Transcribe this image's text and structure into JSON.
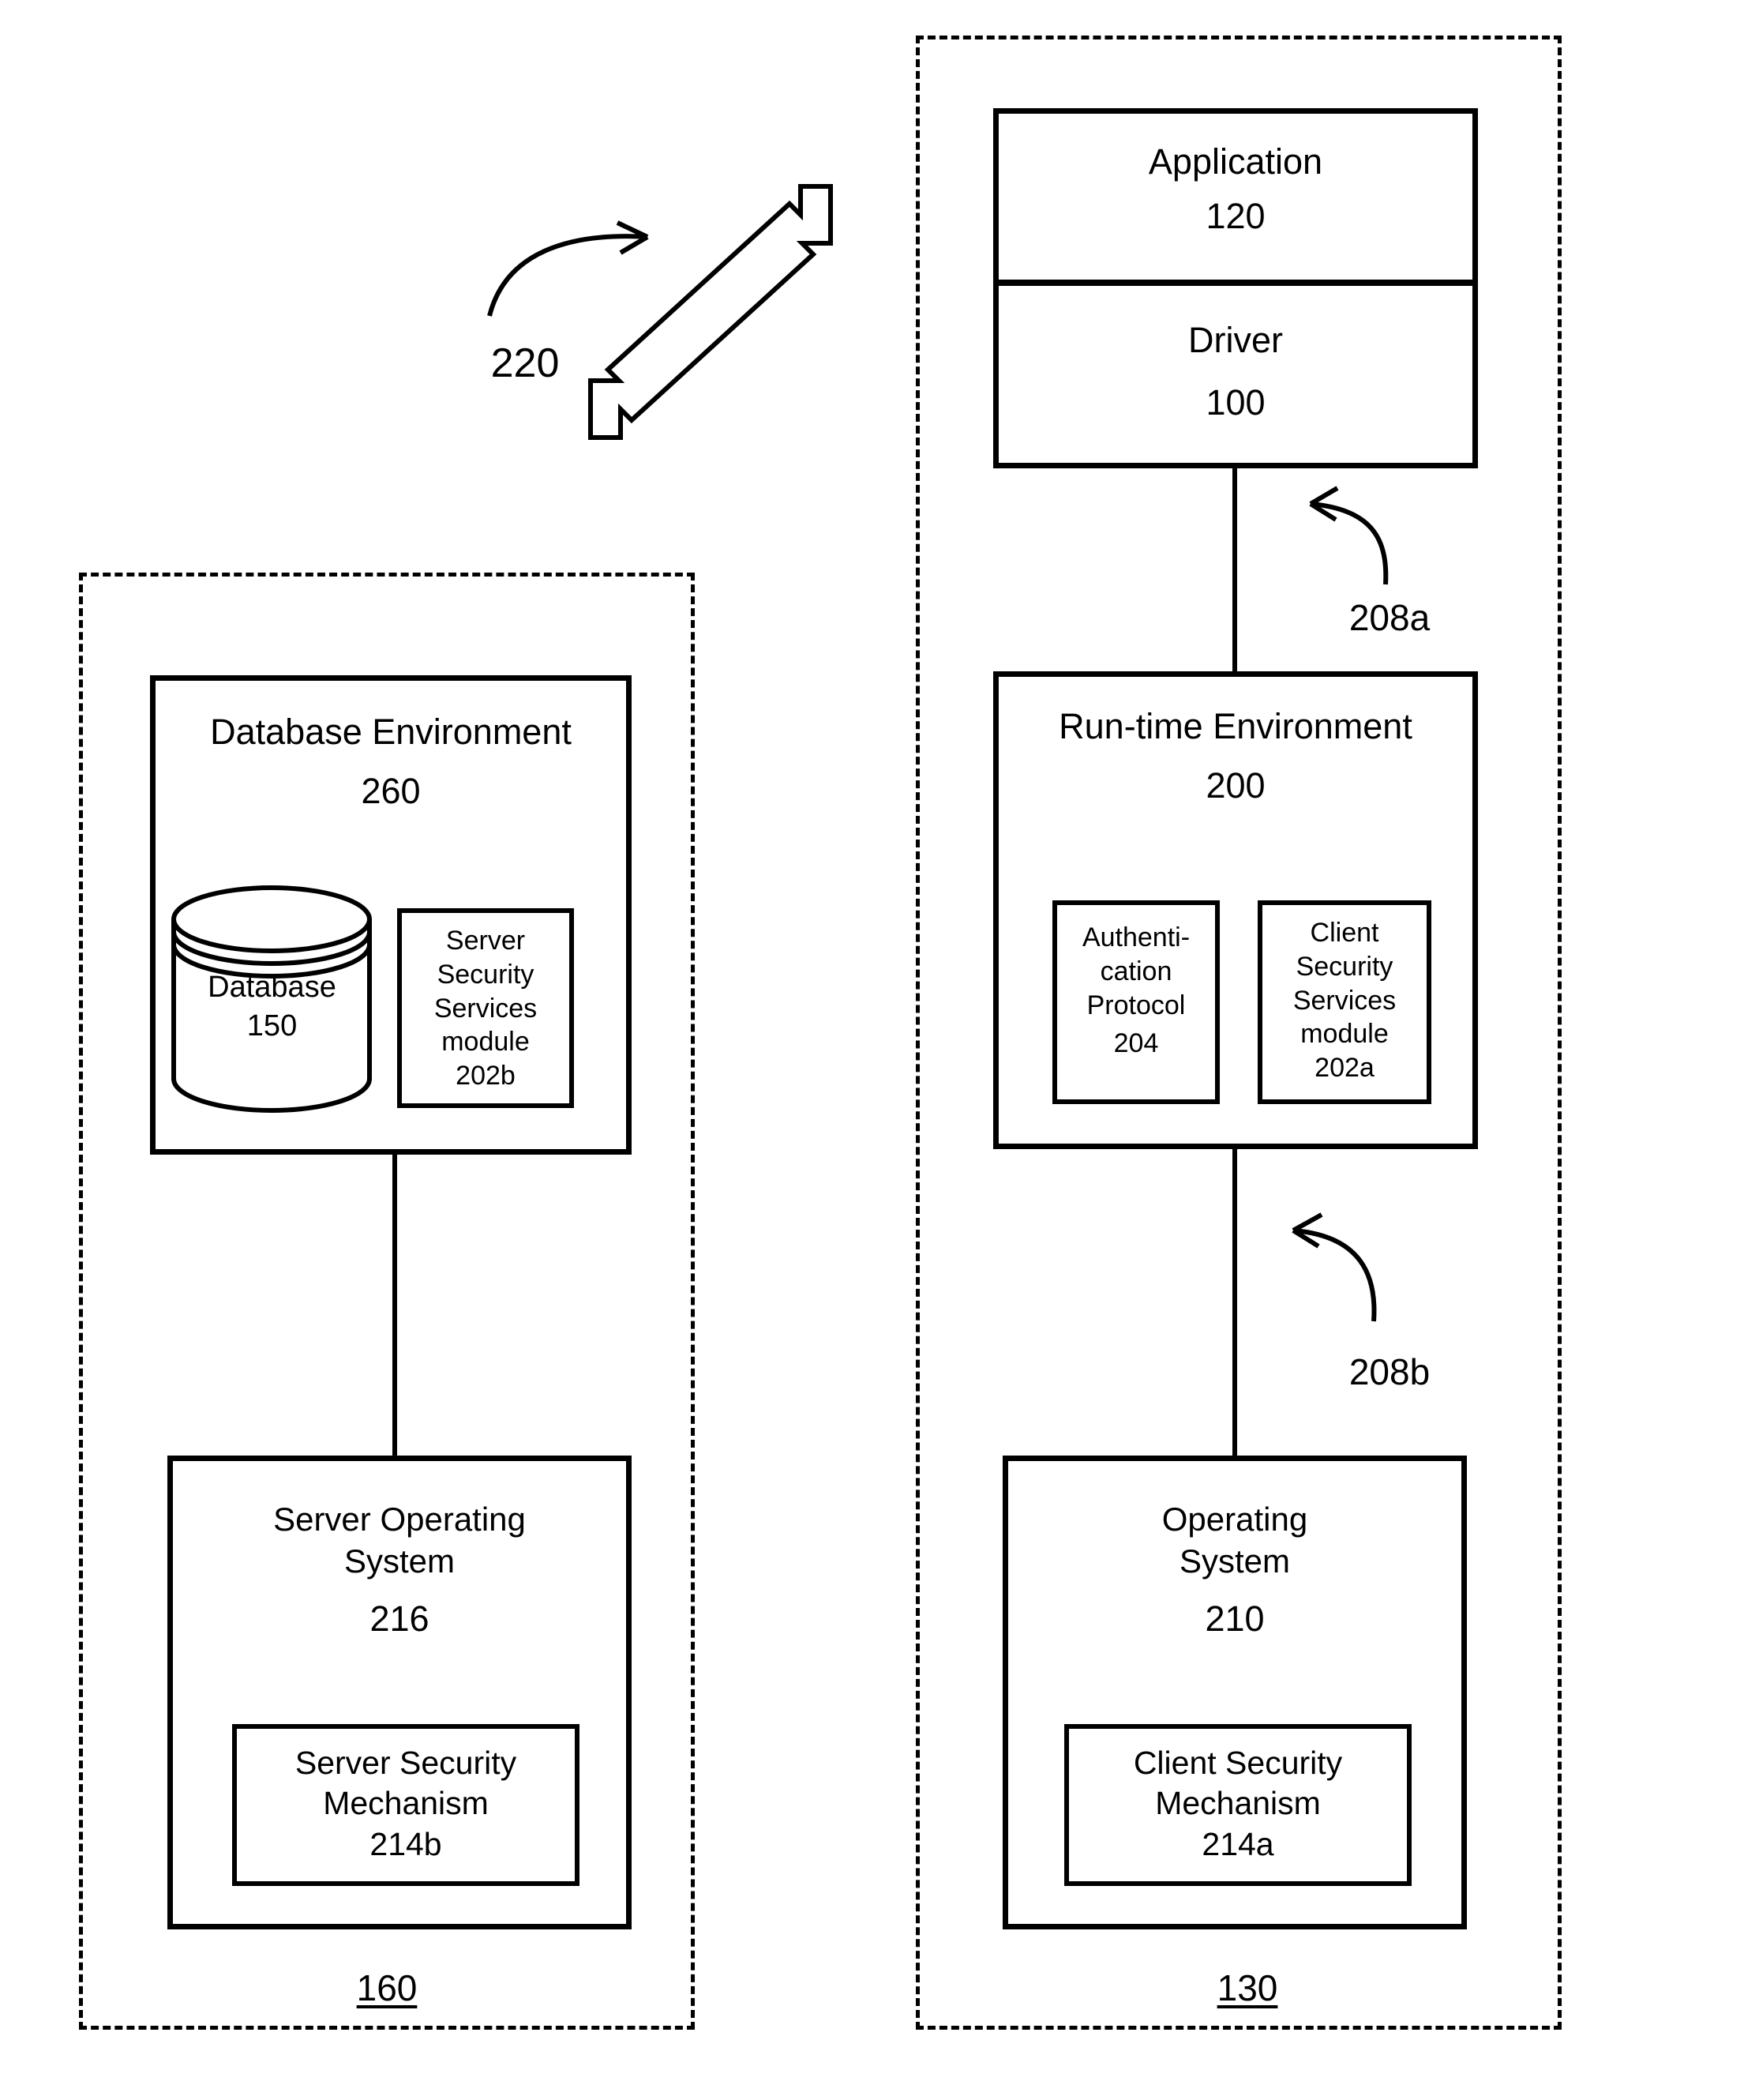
{
  "diagram": {
    "left_system": {
      "ref": "160",
      "database_environment": {
        "title": "Database Environment",
        "ref": "260",
        "database": {
          "label": "Database",
          "ref": "150",
          "icon": "database-cylinder-icon"
        },
        "server_security_services_module": {
          "lines": [
            "Server",
            "Security",
            "Services",
            "module"
          ],
          "ref": "202b"
        }
      },
      "server_operating_system": {
        "lines": [
          "Server Operating",
          "System"
        ],
        "ref": "216",
        "server_security_mechanism": {
          "lines": [
            "Server Security",
            "Mechanism"
          ],
          "ref": "214b"
        }
      }
    },
    "right_system": {
      "ref": "130",
      "application": {
        "title": "Application",
        "ref": "120"
      },
      "driver": {
        "title": "Driver",
        "ref": "100"
      },
      "runtime_environment": {
        "title": "Run-time Environment",
        "ref": "200",
        "authentication_protocol": {
          "lines": [
            "Authenti-",
            "cation",
            "Protocol"
          ],
          "ref": "204"
        },
        "client_security_services_module": {
          "lines": [
            "Client",
            "Security",
            "Services",
            "module"
          ],
          "ref": "202a"
        }
      },
      "operating_system": {
        "lines": [
          "Operating",
          "System"
        ],
        "ref": "210",
        "client_security_mechanism": {
          "lines": [
            "Client Security",
            "Mechanism"
          ],
          "ref": "214a"
        }
      }
    },
    "callouts": {
      "interconnect": "220",
      "driver_to_runtime": "208a",
      "runtime_to_os": "208b"
    },
    "colors": {
      "line": "#000000",
      "background": "#ffffff"
    }
  }
}
